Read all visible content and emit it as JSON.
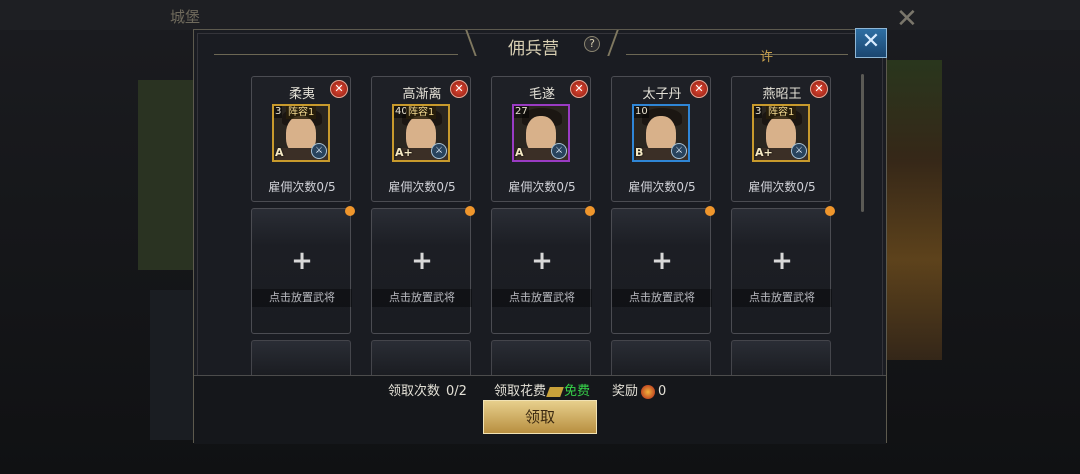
{
  "background": {
    "title": "城堡"
  },
  "dialog": {
    "title": "佣兵营",
    "side_char": "许"
  },
  "generals": [
    {
      "name": "柔夷",
      "level": "3",
      "formation": "阵容1",
      "grade": "A",
      "hire": "雇佣次数0/5",
      "frame": "gold"
    },
    {
      "name": "高渐离",
      "level": "40",
      "formation": "阵容1",
      "grade": "A+",
      "hire": "雇佣次数0/5",
      "frame": "gold"
    },
    {
      "name": "毛遂",
      "level": "27",
      "formation": "",
      "grade": "A",
      "hire": "雇佣次数0/5",
      "frame": "purple"
    },
    {
      "name": "太子丹",
      "level": "10",
      "formation": "",
      "grade": "B",
      "hire": "雇佣次数0/5",
      "frame": "blue"
    },
    {
      "name": "燕昭王",
      "level": "3",
      "formation": "阵容1",
      "grade": "A+",
      "hire": "雇佣次数0/5",
      "frame": "gold"
    }
  ],
  "slots": [
    {
      "text": "点击放置武将"
    },
    {
      "text": "点击放置武将"
    },
    {
      "text": "点击放置武将"
    },
    {
      "text": "点击放置武将"
    },
    {
      "text": "点击放置武将"
    }
  ],
  "footer": {
    "claim_count_label": "领取次数",
    "claim_count_value": "0/2",
    "claim_cost_label": "领取花费",
    "claim_cost_value": "免费",
    "reward_label": "奖励",
    "reward_value": "0",
    "claim_button": "领取"
  }
}
